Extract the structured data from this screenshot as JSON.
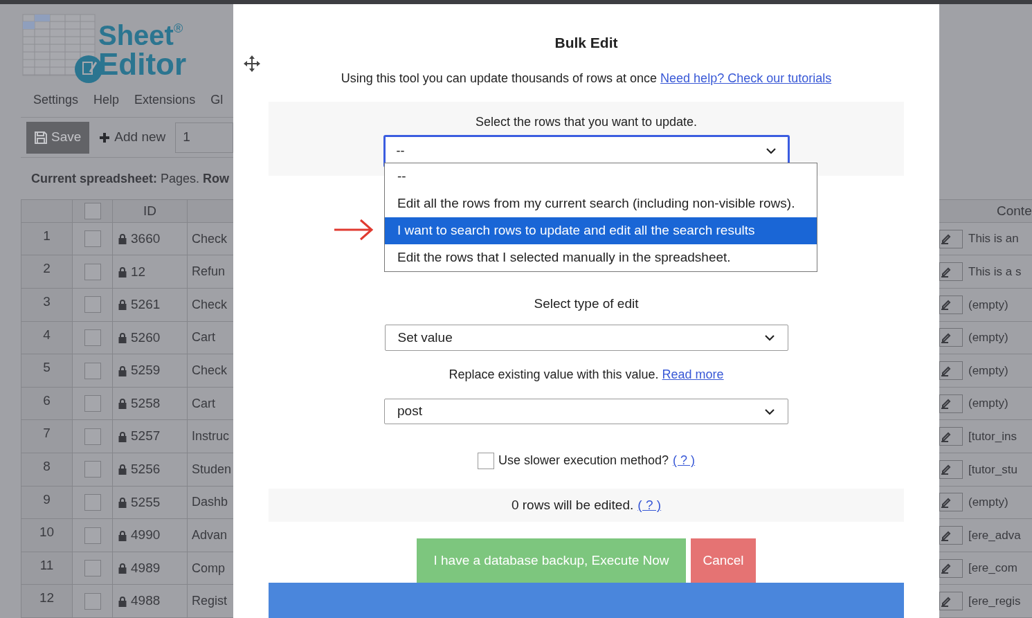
{
  "app": {
    "logo": {
      "line1": "Sheet",
      "line2": "Editor",
      "mark": "®"
    },
    "menu": [
      "Settings",
      "Help",
      "Extensions",
      "Gl"
    ],
    "toolbar": {
      "save": "Save",
      "add_new": "Add new",
      "count_value": "1"
    },
    "current_spreadsheet": "**Current spreadsheet:** Pages. **Row**",
    "table": {
      "header_checked": false,
      "columns": [
        "ID",
        "Conte"
      ],
      "rows": [
        {
          "number": "1",
          "checked": false,
          "id": "3660",
          "title": "Check",
          "content": "This is an"
        },
        {
          "number": "2",
          "checked": false,
          "id": "12",
          "title": "Refun",
          "content": "This is a s"
        },
        {
          "number": "3",
          "checked": false,
          "id": "5261",
          "title": "Check",
          "content": "(empty)"
        },
        {
          "number": "4",
          "checked": false,
          "id": "5260",
          "title": "Cart",
          "content": "(empty)"
        },
        {
          "number": "5",
          "checked": false,
          "id": "5259",
          "title": "Check",
          "content": "(empty)"
        },
        {
          "number": "6",
          "checked": false,
          "id": "5258",
          "title": "Cart",
          "content": "(empty)"
        },
        {
          "number": "7",
          "checked": false,
          "id": "5257",
          "title": "Instruc",
          "content": "[tutor_ins"
        },
        {
          "number": "8",
          "checked": false,
          "id": "5256",
          "title": "Studen",
          "content": "[tutor_stu"
        },
        {
          "number": "9",
          "checked": false,
          "id": "5255",
          "title": "Dashb",
          "content": "(empty)"
        },
        {
          "number": "10",
          "checked": false,
          "id": "4990",
          "title": "Advan",
          "content": "[ere_adva"
        },
        {
          "number": "11",
          "checked": false,
          "id": "4989",
          "title": "Comp",
          "content": "[ere_com"
        },
        {
          "number": "12",
          "checked": false,
          "id": "4988",
          "title": "Regist",
          "content": "[ere_regis"
        }
      ]
    }
  },
  "modal": {
    "title": "Bulk Edit",
    "description": "Using this tool you can update thousands of rows at once",
    "help_link": "Need help? Check our tutorials",
    "rows_select": {
      "label": "Select the rows that you want to update.",
      "value": "--",
      "open": true,
      "options": [
        {
          "label": "--",
          "highlighted": false
        },
        {
          "label": "Edit all the rows from my current search (including non-visible rows).",
          "highlighted": false
        },
        {
          "label": "I want to search rows to update and edit all the search results",
          "highlighted": true
        },
        {
          "label": "Edit the rows that I selected manually in the spreadsheet.",
          "highlighted": false
        }
      ]
    },
    "edit_type": {
      "label": "Select type of edit",
      "value": "Set value"
    },
    "hint": "Replace existing value with this value.",
    "hint_link": "Read more",
    "value_select": {
      "value": "post"
    },
    "slower": {
      "label": "Use slower execution method?",
      "help": "( ? )",
      "checked": false
    },
    "count": {
      "text": "0 rows will be edited.",
      "help": "( ? )"
    },
    "execute_button": "I have a database backup, Execute Now",
    "cancel_button": "Cancel"
  }
}
